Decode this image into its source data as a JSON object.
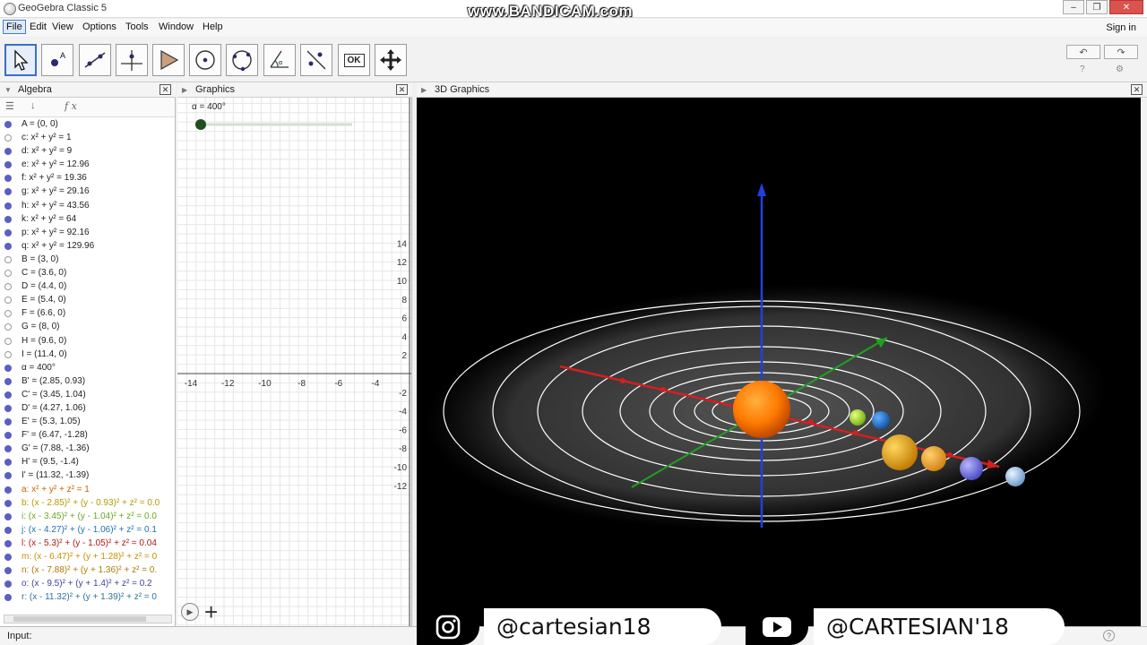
{
  "window": {
    "title": "GeoGebra Classic 5",
    "watermark": "www.BANDICAM.com",
    "controls": [
      "–",
      "❐",
      "✕"
    ]
  },
  "menu": {
    "items": [
      "File",
      "Edit",
      "View",
      "Options",
      "Tools",
      "Window",
      "Help"
    ],
    "sign_in": "Sign in"
  },
  "toolbar": {
    "tools": [
      "move-tool",
      "point-tool",
      "line-tool",
      "perpendicular-line-tool",
      "polygon-tool",
      "circle-center-point-tool",
      "circle-three-points-tool",
      "angle-tool",
      "reflect-tool",
      "slider-tool",
      "move-graphics-view-tool"
    ],
    "slider_tool_label": "OK",
    "undo_label": "↶",
    "redo_label": "↷"
  },
  "panels": {
    "algebra": "Algebra",
    "graphics": "Graphics",
    "graphics3d": "3D Graphics",
    "close_glyph": "✕"
  },
  "algebra": {
    "toolbar": [
      "☰",
      "↓",
      "f x"
    ],
    "rows": [
      {
        "text": "A = (0, 0)",
        "shown": true,
        "color": "#222"
      },
      {
        "text": "c: x² + y² = 1",
        "shown": false,
        "color": "#222"
      },
      {
        "text": "d: x² + y² = 9",
        "shown": true,
        "color": "#222"
      },
      {
        "text": "e: x² + y² = 12.96",
        "shown": true,
        "color": "#222"
      },
      {
        "text": "f: x² + y² = 19.36",
        "shown": true,
        "color": "#222"
      },
      {
        "text": "g: x² + y² = 29.16",
        "shown": true,
        "color": "#222"
      },
      {
        "text": "h: x² + y² = 43.56",
        "shown": true,
        "color": "#222"
      },
      {
        "text": "k: x² + y² = 64",
        "shown": true,
        "color": "#222"
      },
      {
        "text": "p: x² + y² = 92.16",
        "shown": true,
        "color": "#222"
      },
      {
        "text": "q: x² + y² = 129.96",
        "shown": true,
        "color": "#222"
      },
      {
        "text": "B = (3, 0)",
        "shown": false,
        "color": "#222"
      },
      {
        "text": "C = (3.6, 0)",
        "shown": false,
        "color": "#222"
      },
      {
        "text": "D = (4.4, 0)",
        "shown": false,
        "color": "#222"
      },
      {
        "text": "E = (5.4, 0)",
        "shown": false,
        "color": "#222"
      },
      {
        "text": "F = (6.6, 0)",
        "shown": false,
        "color": "#222"
      },
      {
        "text": "G = (8, 0)",
        "shown": false,
        "color": "#222"
      },
      {
        "text": "H = (9.6, 0)",
        "shown": false,
        "color": "#222"
      },
      {
        "text": "I = (11.4, 0)",
        "shown": false,
        "color": "#222"
      },
      {
        "text": "α = 400°",
        "shown": true,
        "color": "#222"
      },
      {
        "text": "B' = (2.85, 0.93)",
        "shown": true,
        "color": "#222"
      },
      {
        "text": "C' = (3.45, 1.04)",
        "shown": true,
        "color": "#222"
      },
      {
        "text": "D' = (4.27, 1.06)",
        "shown": true,
        "color": "#222"
      },
      {
        "text": "E' = (5.3, 1.05)",
        "shown": true,
        "color": "#222"
      },
      {
        "text": "F' = (6.47, -1.28)",
        "shown": true,
        "color": "#222"
      },
      {
        "text": "G' = (7.88, -1.36)",
        "shown": true,
        "color": "#222"
      },
      {
        "text": "H' = (9.5, -1.4)",
        "shown": true,
        "color": "#222"
      },
      {
        "text": "I' = (11.32, -1.39)",
        "shown": true,
        "color": "#222"
      },
      {
        "text": "a: x² + y² + z² = 1",
        "shown": true,
        "color": "#c86400"
      },
      {
        "text": "b: (x - 2.85)² + (y - 0.93)² + z² = 0.0",
        "shown": true,
        "color": "#b89800"
      },
      {
        "text": "i: (x - 3.45)² + (y - 1.04)² + z² = 0.0",
        "shown": true,
        "color": "#6aa820"
      },
      {
        "text": "j: (x - 4.27)² + (y - 1.06)² + z² = 0.1",
        "shown": true,
        "color": "#1e6fb8"
      },
      {
        "text": "l: (x - 5.3)² + (y - 1.05)² + z² = 0.04",
        "shown": true,
        "color": "#b01818"
      },
      {
        "text": "m: (x - 6.47)² + (y + 1.28)² + z² = 0",
        "shown": true,
        "color": "#c89000"
      },
      {
        "text": "n: (x - 7.88)² + (y + 1.36)² + z² = 0.",
        "shown": true,
        "color": "#b07a00"
      },
      {
        "text": "o: (x - 9.5)² + (y + 1.4)² + z² = 0.2",
        "shown": true,
        "color": "#4040a8"
      },
      {
        "text": "r: (x - 11.32)² + (y + 1.39)² + z² = 0",
        "shown": true,
        "color": "#3070a0"
      }
    ],
    "scroll_glyph": "III"
  },
  "graphics2d": {
    "slider_label": "α = 400°",
    "slider_value": 0.0,
    "y_ticks": [
      "14",
      "12",
      "10",
      "8",
      "6",
      "4",
      "2",
      "-2",
      "-4",
      "-6",
      "-8",
      "-10",
      "-12"
    ],
    "x_ticks": [
      "-14",
      "-12",
      "-10",
      "-8",
      "-6",
      "-4"
    ],
    "play_glyph": "▶",
    "plus_glyph": "+"
  },
  "graphics3d": {
    "background": "#000000",
    "axis_colors": {
      "x": "#d22020",
      "y": "#20a020",
      "z": "#2040e0"
    },
    "planet_colors": [
      "#ff8c00",
      "#a8e020",
      "#1e78d8",
      "#e8a020",
      "#f0a030",
      "#7070e0",
      "#a0c8f0"
    ]
  },
  "input": {
    "label": "Input:",
    "value": "",
    "help_glyph": "?"
  },
  "overlay": {
    "instagram": "@cartesian18",
    "youtube": "@CARTESIAN'18"
  }
}
